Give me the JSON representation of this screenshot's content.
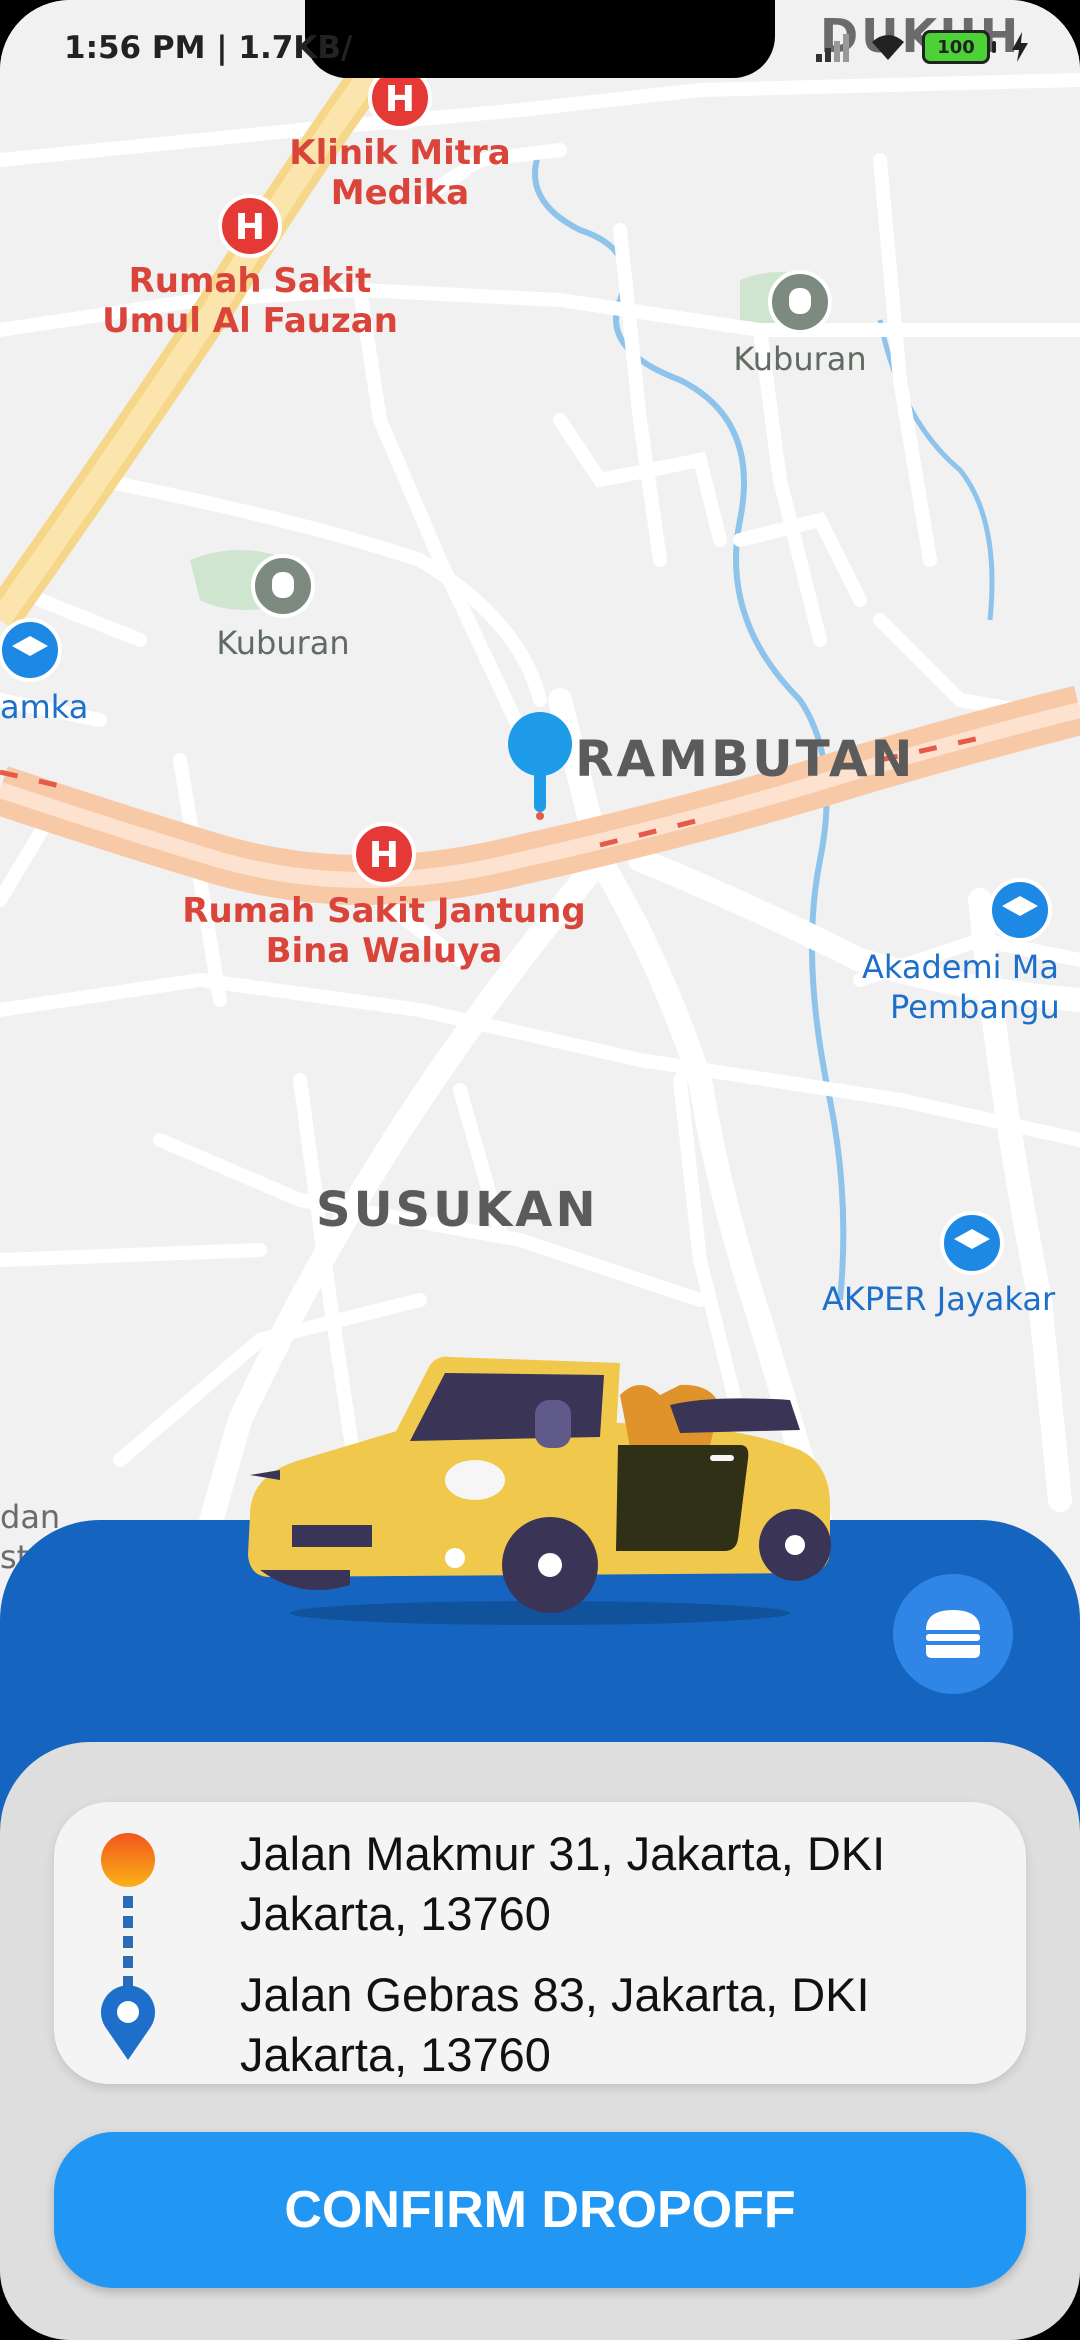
{
  "status_bar": {
    "time_and_speed": "1:56 PM | 1.7KB/",
    "battery": "100"
  },
  "map": {
    "labels": {
      "dukuh": "DUKUH",
      "klinik_line1": "Klinik Mitra",
      "klinik_line2": "Medika",
      "rs_umul_line1": "Rumah Sakit",
      "rs_umul_line2": "Umul Al Fauzan",
      "kuburan_top": "Kuburan",
      "kuburan_left": "Kuburan",
      "amka": "amka",
      "rambutan": "RAMBUTAN",
      "rs_jantung_line1": "Rumah Sakit Jantung",
      "rs_jantung_line2": "Bina Waluya",
      "akademi_line1": "Akademi Ma",
      "akademi_line2": "Pembangu",
      "susukan": "SUSUKAN",
      "akper": "AKPER Jayakar",
      "dan_line1": "dan",
      "dan_line2": "str"
    }
  },
  "icons": {
    "menu": "hamburger-menu-icon",
    "origin": "origin-dot-icon",
    "destination": "location-pin-icon",
    "map_pin": "map-marker-icon",
    "hospital": "hospital-icon",
    "school": "school-icon",
    "cemetery": "cemetery-icon",
    "car": "convertible-car-illustration"
  },
  "trip": {
    "pickup": "Jalan Makmur 31, Jakarta, DKI Jakarta, 13760",
    "dropoff": "Jalan Gebras 83, Jakarta, DKI Jakarta, 13760"
  },
  "actions": {
    "confirm_label": "CONFIRM DROPOFF"
  },
  "colors": {
    "panel": "#1565c0",
    "button": "#2196f3",
    "pin": "#1e9be9",
    "hospital": "#e53935",
    "car": "#f0c94c"
  }
}
